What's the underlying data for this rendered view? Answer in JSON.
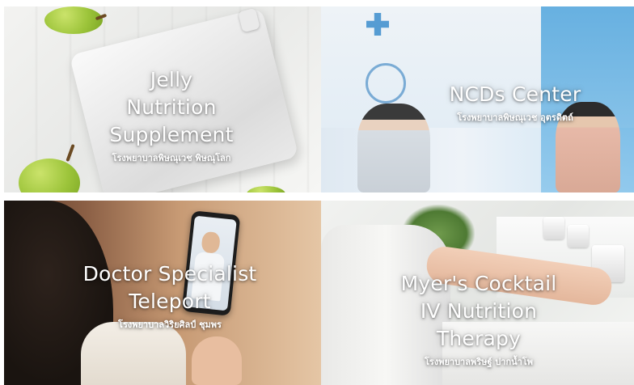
{
  "tiles": [
    {
      "title_lines": [
        "Jelly Nutrition",
        "Supplement"
      ],
      "subtitle": "โรงพยาบาลพิษณุเวช พิษณุโลก"
    },
    {
      "title_lines": [
        "NCDs Center"
      ],
      "subtitle": "โรงพยาบาลพิษณุเวช อุตรดิตถ์"
    },
    {
      "title_lines": [
        "Doctor Specialist",
        "Teleport"
      ],
      "subtitle": "โรงพยาบาลวิริยศิลป์ ชุมพร"
    },
    {
      "title_lines": [
        "Myer's Cocktail",
        "IV Nutrition Therapy"
      ],
      "subtitle": "โรงพยาบาลพริษฐ์ ปากน้ำโพ"
    }
  ]
}
